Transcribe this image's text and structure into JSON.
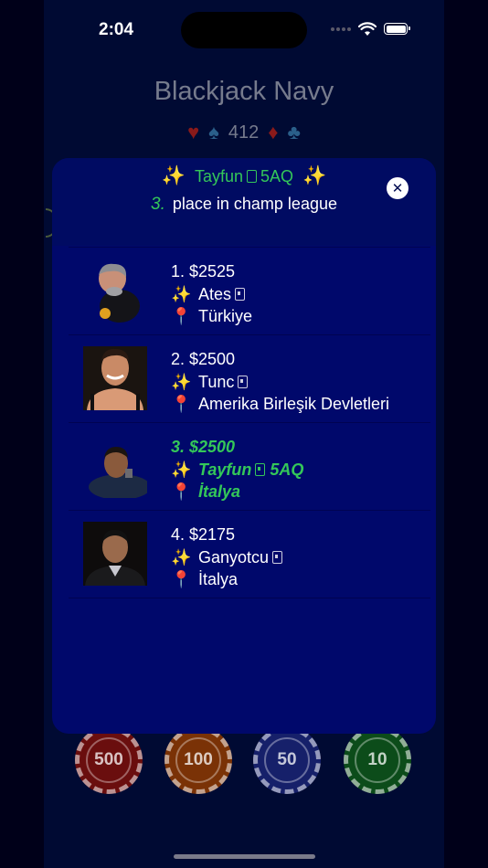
{
  "status_bar": {
    "time": "2:04"
  },
  "game": {
    "title": "Blackjack Navy",
    "coins": "412",
    "suits": [
      "♥",
      "♠",
      "♦",
      "♣"
    ]
  },
  "chips": [
    {
      "value": "500",
      "color": "#8a1010"
    },
    {
      "value": "100",
      "color": "#8a3a06"
    },
    {
      "value": "50",
      "color": "#1a2a7a"
    },
    {
      "value": "10",
      "color": "#0e5a1e"
    }
  ],
  "modal": {
    "player_name": "Tayfun",
    "player_hand": "5AQ",
    "rank": "3.",
    "rank_text": "place in champ league",
    "close_icon": "close-icon"
  },
  "leaderboard": [
    {
      "rank_amount": "1.  $2525",
      "name": "Ates",
      "hand": "",
      "country": "Türkiye",
      "highlight": false
    },
    {
      "rank_amount": "2.  $2500",
      "name": "Tunc",
      "hand": "",
      "country": "Amerika Birleşik Devletleri",
      "highlight": false
    },
    {
      "rank_amount": "3.  $2500",
      "name": "Tayfun",
      "hand": "5AQ",
      "country": "İtalya",
      "highlight": true
    },
    {
      "rank_amount": "4.  $2175",
      "name": "Ganyotcu",
      "hand": "",
      "country": "İtalya",
      "highlight": false
    }
  ],
  "colors": {
    "background": "#000a33",
    "modal": "#00086b",
    "accent_green": "#34c759"
  }
}
